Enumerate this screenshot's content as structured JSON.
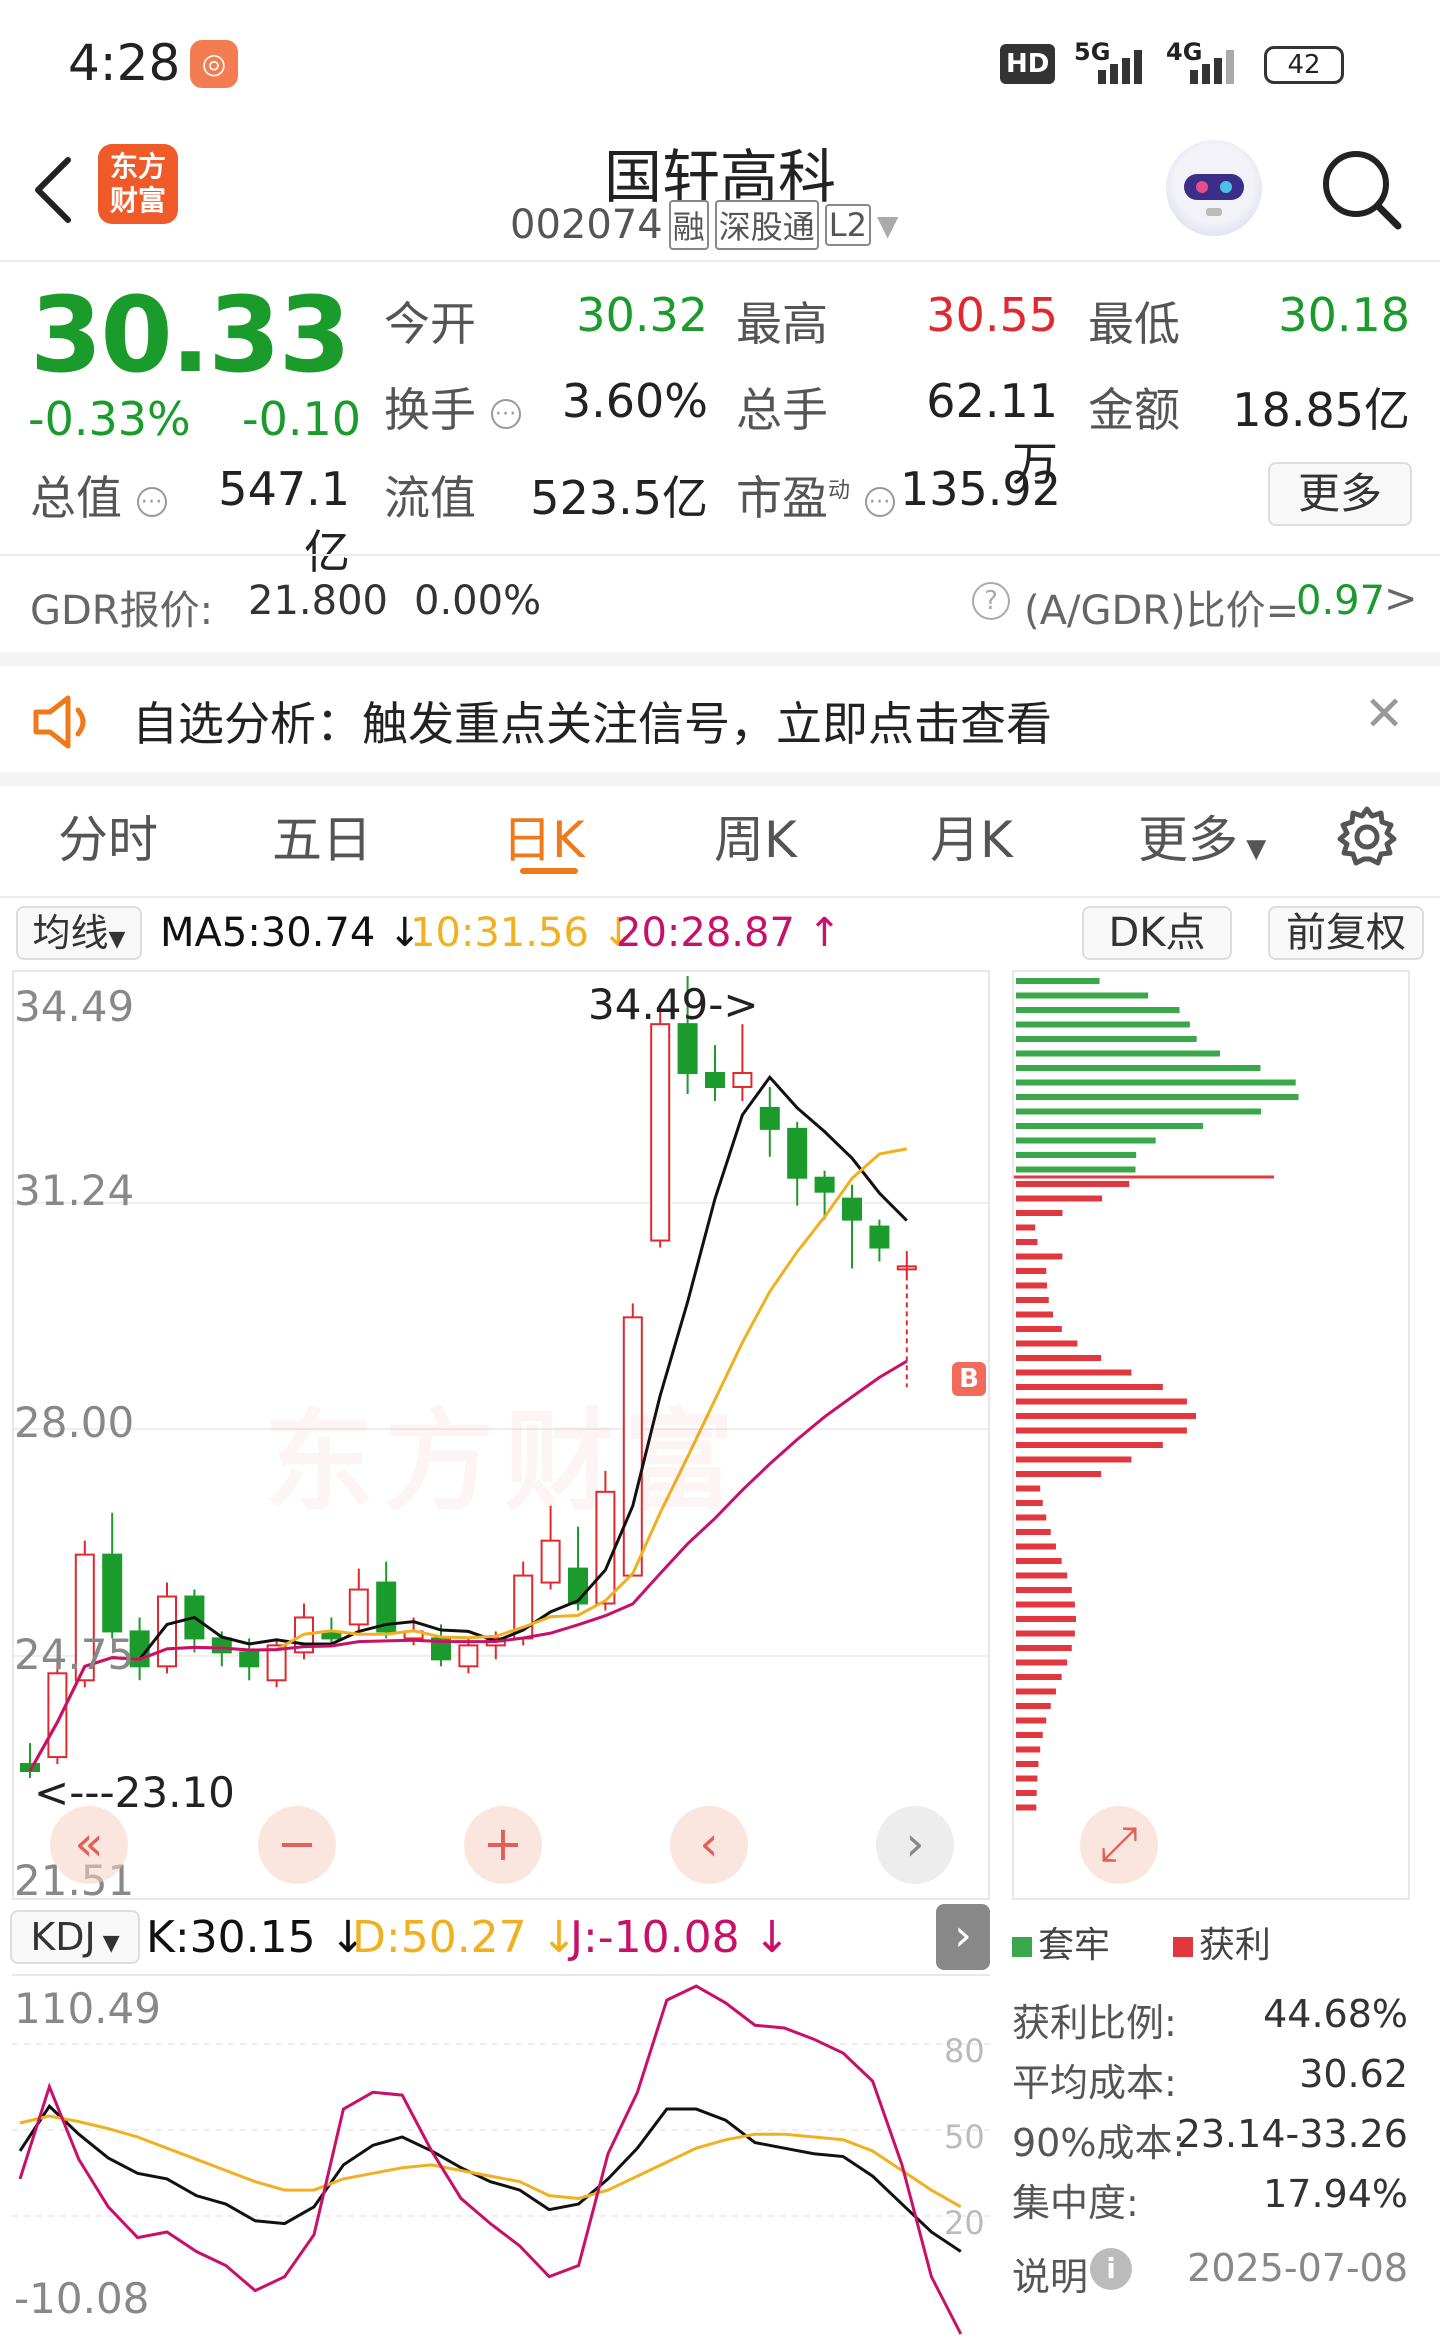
{
  "status": {
    "time": "4:28",
    "hd": "HD",
    "net1": "5G",
    "net2": "4G",
    "battery": "42"
  },
  "header": {
    "title": "国轩高科",
    "code": "002074",
    "tags": [
      "融",
      "深股通",
      "L2"
    ],
    "logo_text": [
      "东方",
      "财富"
    ]
  },
  "quote": {
    "price": "30.33",
    "change_pct": "-0.33%",
    "change": "-0.10",
    "rows": [
      [
        {
          "label": "今开",
          "value": "30.32",
          "color": "#1a9b2b"
        },
        {
          "label": "最高",
          "value": "30.55",
          "color": "#e0282f"
        },
        {
          "label": "最低",
          "value": "30.18",
          "color": "#1a9b2b"
        }
      ],
      [
        {
          "label": "换手",
          "value": "3.60%",
          "color": "#222"
        },
        {
          "label": "总手",
          "value": "62.11万",
          "color": "#222"
        },
        {
          "label": "金额",
          "value": "18.85亿",
          "color": "#222"
        }
      ],
      [
        {
          "label": "总值",
          "value": "547.1亿",
          "color": "#222"
        },
        {
          "label": "流值",
          "value": "523.5亿",
          "color": "#222"
        },
        {
          "label": "市盈",
          "value": "135.92",
          "color": "#222"
        }
      ]
    ],
    "pe_sup": "动",
    "more": "更多"
  },
  "gdr": {
    "label": "GDR报价:",
    "price": "21.800",
    "pct": "0.00%",
    "ratio_label": "(A/GDR)比价=",
    "ratio_value": "0.97",
    "arrow": ">"
  },
  "notice": {
    "text": "自选分析：触发重点关注信号，立即点击查看",
    "close": "✕"
  },
  "tabs": [
    "分时",
    "五日",
    "日K",
    "周K",
    "月K",
    "更多"
  ],
  "active_tab": "日K",
  "ma_bar": {
    "selector": "均线",
    "ma5": "MA5:30.74",
    "ma10": "10:31.56",
    "ma20": "20:28.87",
    "dk": "DK点",
    "fq": "前复权"
  },
  "kline": {
    "y_labels": [
      "34.49",
      "31.24",
      "28.00",
      "24.75",
      "21.51"
    ],
    "high_annot": "34.49->",
    "low_annot": "<---23.10",
    "marker": "B",
    "watermark": "东方财富",
    "buttons": [
      "«",
      "−",
      "+",
      "‹",
      "›",
      "⤢"
    ]
  },
  "kdj_bar": {
    "selector": "KDJ",
    "k": "K:30.15",
    "d": "D:50.27",
    "j": "J:-10.08"
  },
  "kdj": {
    "y_labels": [
      "110.49",
      "-10.08"
    ],
    "right_labels": [
      "80",
      "50",
      "20"
    ]
  },
  "chip": {
    "legend": [
      {
        "label": "套牢",
        "color": "#3aa84a"
      },
      {
        "label": "获利",
        "color": "#e0383e"
      }
    ],
    "stats": [
      {
        "label": "获利比例:",
        "value": "44.68%"
      },
      {
        "label": "平均成本:",
        "value": "30.62"
      },
      {
        "label": "90%成本:",
        "value": "23.14-33.26"
      },
      {
        "label": "集中度:",
        "value": "17.94%"
      }
    ],
    "note_label": "说明",
    "date": "2025-07-08"
  },
  "colors": {
    "up": "#e0282f",
    "down": "#1a9b2b",
    "accent": "#f07a1a",
    "ma5": "#111111",
    "ma10": "#f0b020",
    "ma20": "#c8106a"
  }
}
